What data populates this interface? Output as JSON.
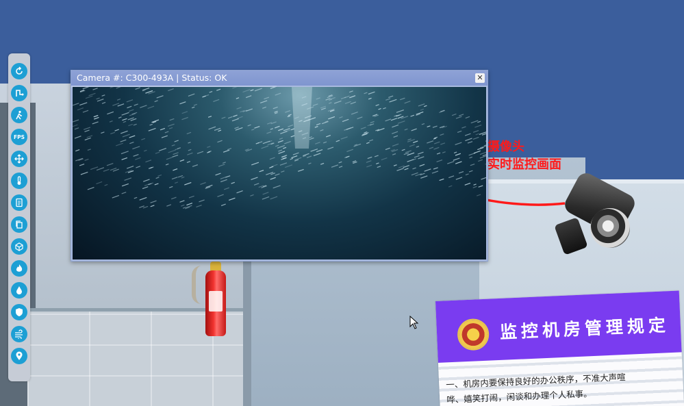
{
  "camera_popup": {
    "title": "Camera #: C300-493A | Status: OK",
    "close_icon": "close-icon"
  },
  "annotation": {
    "line1": "双击摄像头",
    "line2": "调出实时监控画面",
    "color": "#ff1a1a"
  },
  "poster": {
    "title": "监控机房管理规定",
    "line1": "一、机房内要保持良好的办公秩序，不准大声喧",
    "line2": "哗、嬉笑打闹，闲谈和办理个人私事。",
    "header_color": "#7a3cf0"
  },
  "toolbar": {
    "buttons": [
      {
        "icon": "reset-icon"
      },
      {
        "icon": "route-icon"
      },
      {
        "icon": "walk-icon"
      },
      {
        "icon": "fps-icon",
        "label": "FPS"
      },
      {
        "icon": "move-icon"
      },
      {
        "icon": "thermometer-icon"
      },
      {
        "icon": "document-icon"
      },
      {
        "icon": "copy-icon"
      },
      {
        "icon": "cube-icon"
      },
      {
        "icon": "fire-icon"
      },
      {
        "icon": "water-drop-icon"
      },
      {
        "icon": "shield-icon"
      },
      {
        "icon": "wind-icon"
      },
      {
        "icon": "location-pin-icon"
      }
    ],
    "accent": "#1d9fd4"
  }
}
